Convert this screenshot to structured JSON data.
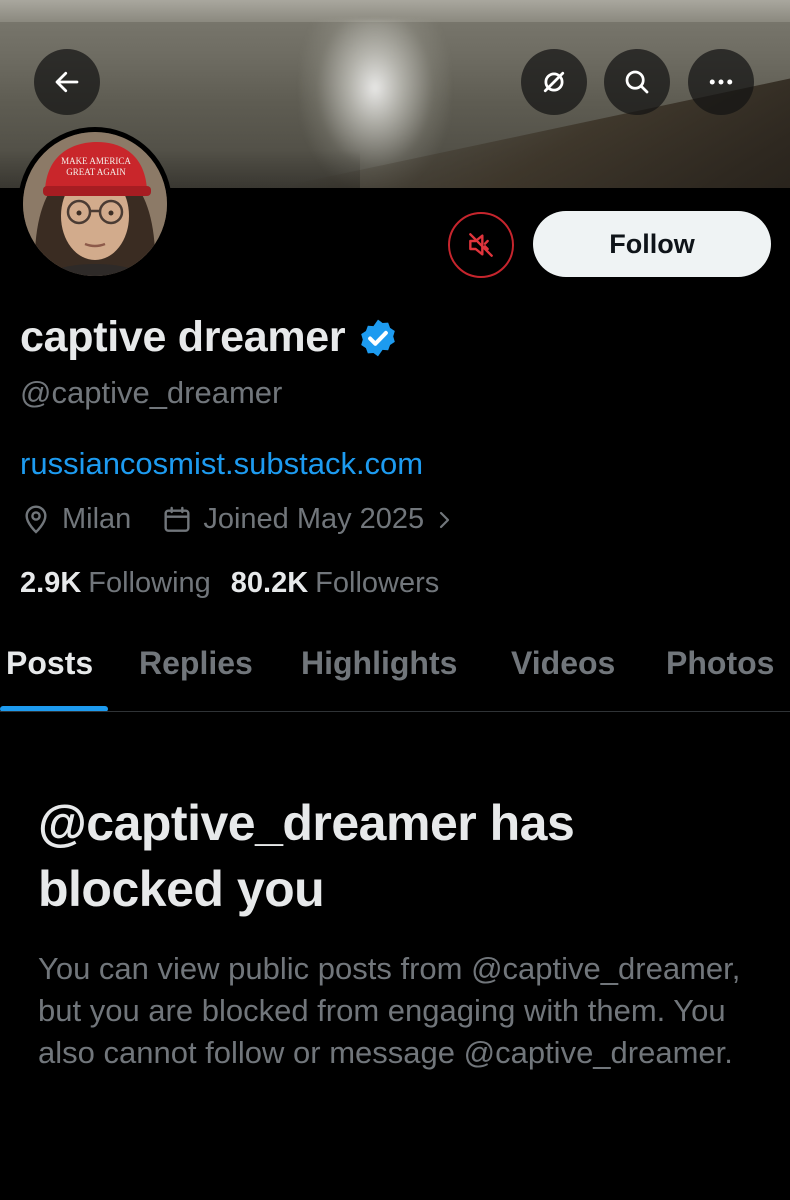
{
  "header": {
    "back_icon": "arrow-left-icon",
    "actions": [
      "no-sync-icon",
      "search-icon",
      "more-icon"
    ]
  },
  "profile": {
    "display_name": "captive dreamer",
    "handle": "@captive_dreamer",
    "website": "russiancosmist.substack.com",
    "location": "Milan",
    "joined": "Joined May 2025",
    "following_count": "2.9K",
    "following_label": "Following",
    "followers_count": "80.2K",
    "followers_label": "Followers",
    "avatar_hat_text": "MAKE AMERICA GREAT AGAIN"
  },
  "actions": {
    "follow_label": "Follow",
    "mute_icon": "muted-speaker-icon"
  },
  "tabs": [
    {
      "label": "Posts",
      "active": true
    },
    {
      "label": "Replies",
      "active": false
    },
    {
      "label": "Highlights",
      "active": false
    },
    {
      "label": "Videos",
      "active": false
    },
    {
      "label": "Photos",
      "active": false
    }
  ],
  "blocked": {
    "title": "@captive_dreamer has blocked you",
    "description": "You can view public posts from @captive_dreamer, but you are blocked from engaging with them. You also cannot follow or message @captive_dreamer."
  },
  "colors": {
    "accent": "#1d9bf0",
    "background": "#000000",
    "muted_text": "#71767b",
    "mute_button_border": "#c6252d"
  }
}
